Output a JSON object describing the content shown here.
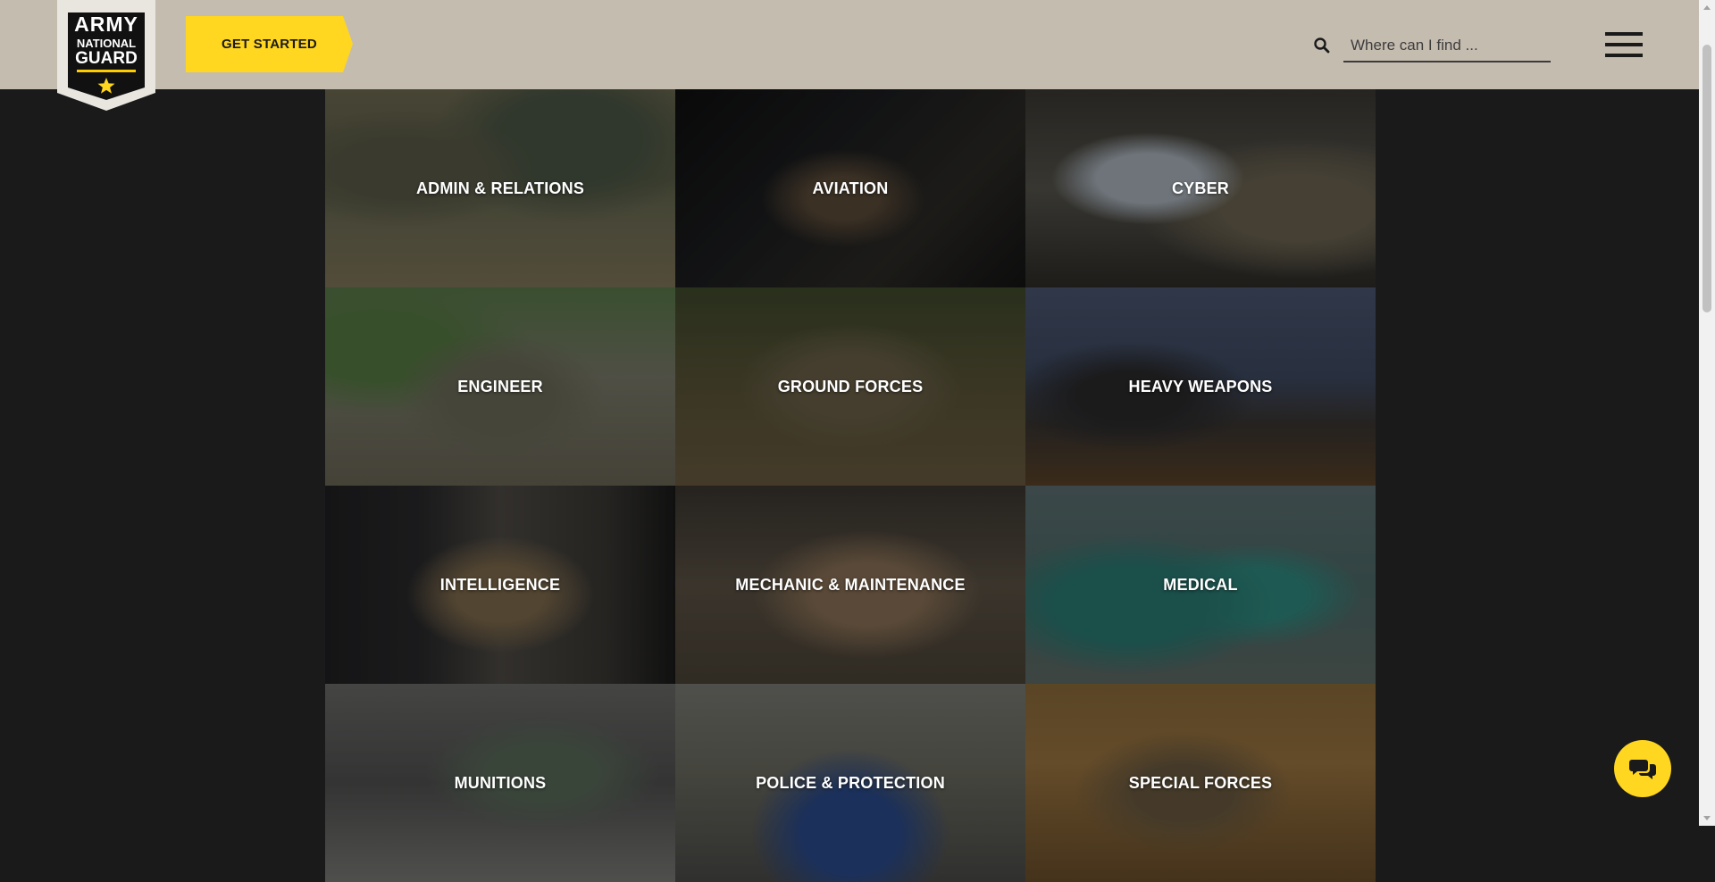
{
  "brand": {
    "logo_line1": "ARMY",
    "logo_line2": "NATIONAL",
    "logo_line3": "GUARD",
    "accent_color": "#ffd620",
    "header_color": "#c5bcb0"
  },
  "header": {
    "cta_label": "GET STARTED",
    "search_placeholder": "Where can I find ...",
    "search_icon": "search-icon",
    "menu_icon": "hamburger-menu-icon"
  },
  "tiles": [
    {
      "label": "ADMIN & RELATIONS"
    },
    {
      "label": "AVIATION"
    },
    {
      "label": "CYBER"
    },
    {
      "label": "ENGINEER"
    },
    {
      "label": "GROUND FORCES"
    },
    {
      "label": "HEAVY WEAPONS"
    },
    {
      "label": "INTELLIGENCE"
    },
    {
      "label": "MECHANIC & MAINTENANCE"
    },
    {
      "label": "MEDICAL"
    },
    {
      "label": "MUNITIONS"
    },
    {
      "label": "POLICE & PROTECTION"
    },
    {
      "label": "SPECIAL FORCES"
    }
  ],
  "chat": {
    "icon": "chat-bubbles-icon"
  }
}
